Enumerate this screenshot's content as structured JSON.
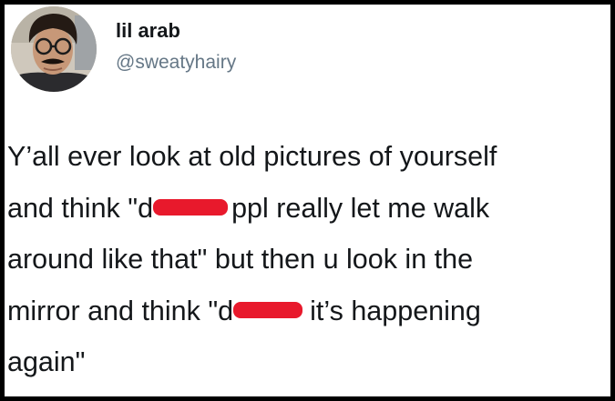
{
  "author": {
    "display_name": "lil arab",
    "handle": "@sweatyhairy"
  },
  "tweet": {
    "line1": "Y’all ever look at old pictures of yourself",
    "line2_before": "and think \"d",
    "line2_after": "ppl really let me walk",
    "line3": "around like that\" but then u look in the",
    "line4_before": "mirror and think \"d",
    "line4_after": "it’s happening",
    "line5": "again\""
  },
  "colors": {
    "redaction": "#e8192c",
    "text": "#14171a",
    "handle": "#657786",
    "border": "#000000"
  }
}
